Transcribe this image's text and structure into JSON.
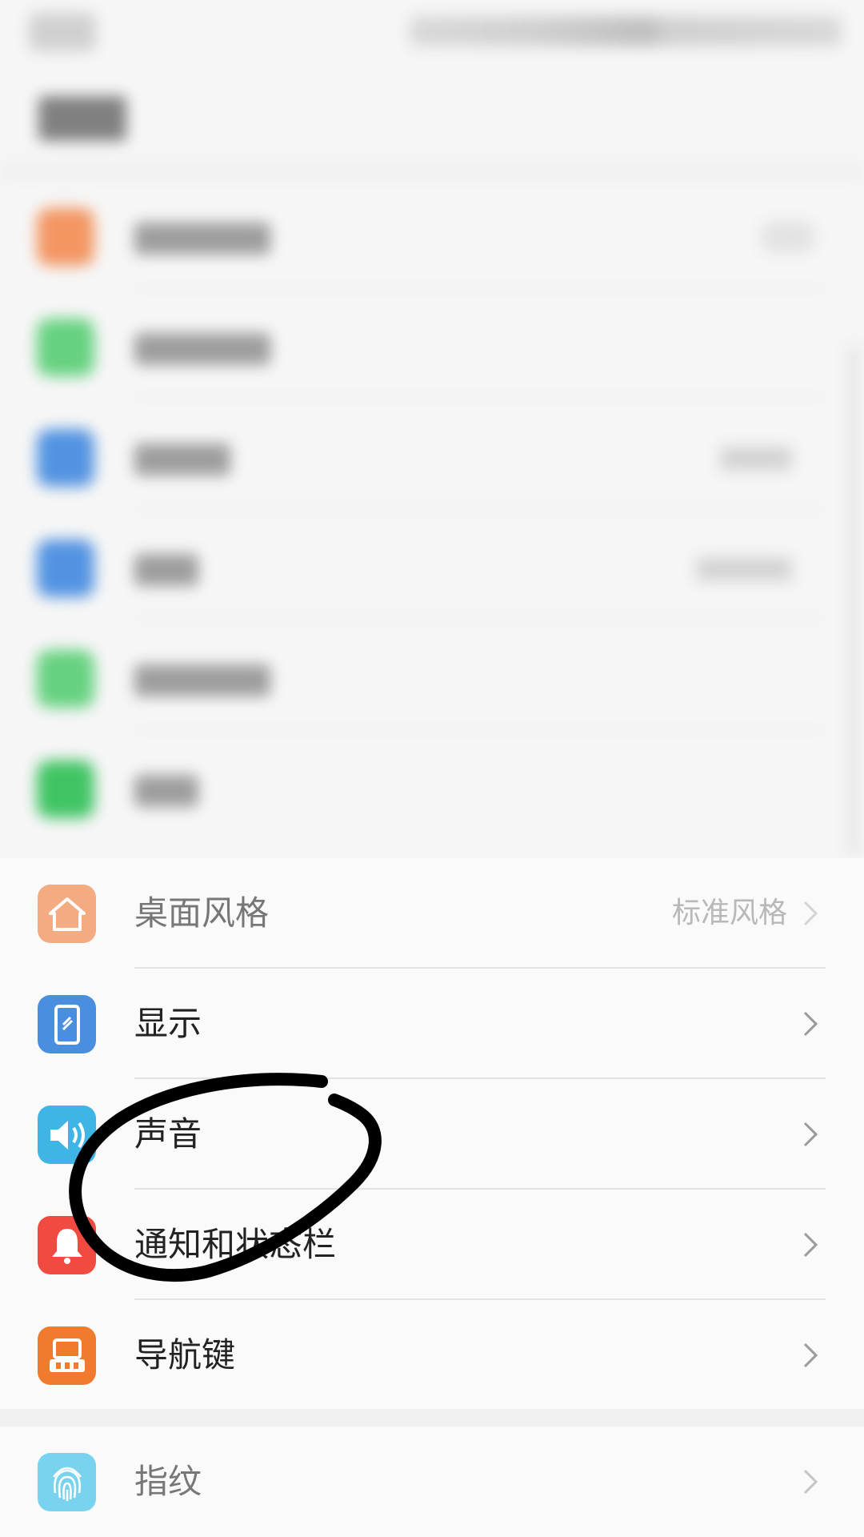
{
  "settings": {
    "items": [
      {
        "label": "桌面风格",
        "value": "标准风格",
        "icon": "home-icon",
        "color": "#f3915b"
      },
      {
        "label": "显示",
        "value": "",
        "icon": "phone-display-icon",
        "color": "#4a8ee0"
      },
      {
        "label": "声音",
        "value": "",
        "icon": "speaker-icon",
        "color": "#3fb5e6"
      },
      {
        "label": "通知和状态栏",
        "value": "",
        "icon": "bell-icon",
        "color": "#f14a41"
      },
      {
        "label": "导航键",
        "value": "",
        "icon": "navigation-key-icon",
        "color": "#f07a2e"
      },
      {
        "label": "指纹",
        "value": "",
        "icon": "fingerprint-icon",
        "color": "#4ec6ea"
      }
    ]
  },
  "blurred_rows_icon_colors": [
    "#f3915b",
    "#5fd07a",
    "#4a8ee0",
    "#4a8ee0",
    "#5fd07a",
    "#37c25c"
  ],
  "annotation": {
    "color": "#000000",
    "shape": "hand-drawn circle around 声音"
  }
}
